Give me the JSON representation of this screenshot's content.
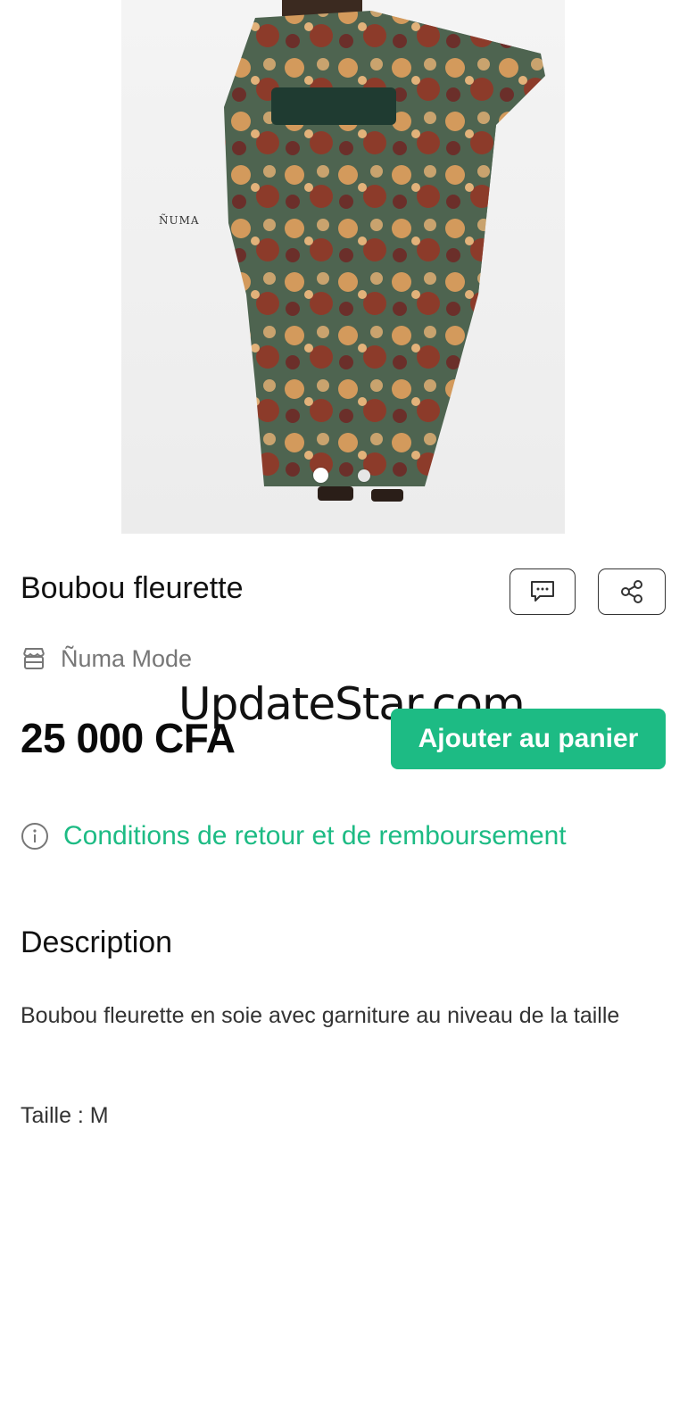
{
  "product": {
    "image_brand_mark": "ÑUMA",
    "title": "Boubou fleurette",
    "shop_name": "Ñuma Mode",
    "price": "25 000 CFA",
    "add_to_cart_label": "Ajouter au panier",
    "return_policy_label": "Conditions de retour et de remboursement",
    "image_carousel": {
      "total": 2,
      "active": 1
    }
  },
  "icons": {
    "chat": "chat-icon",
    "share": "share-icon",
    "shop": "shop-icon",
    "info": "info-icon"
  },
  "description": {
    "heading": "Description",
    "text": "Boubou fleurette en soie avec garniture au niveau de la taille",
    "size": "Taille : M"
  },
  "watermark": "UpdateStar.com",
  "colors": {
    "accent": "#1dbb84",
    "text": "#111111",
    "muted": "#777777"
  }
}
